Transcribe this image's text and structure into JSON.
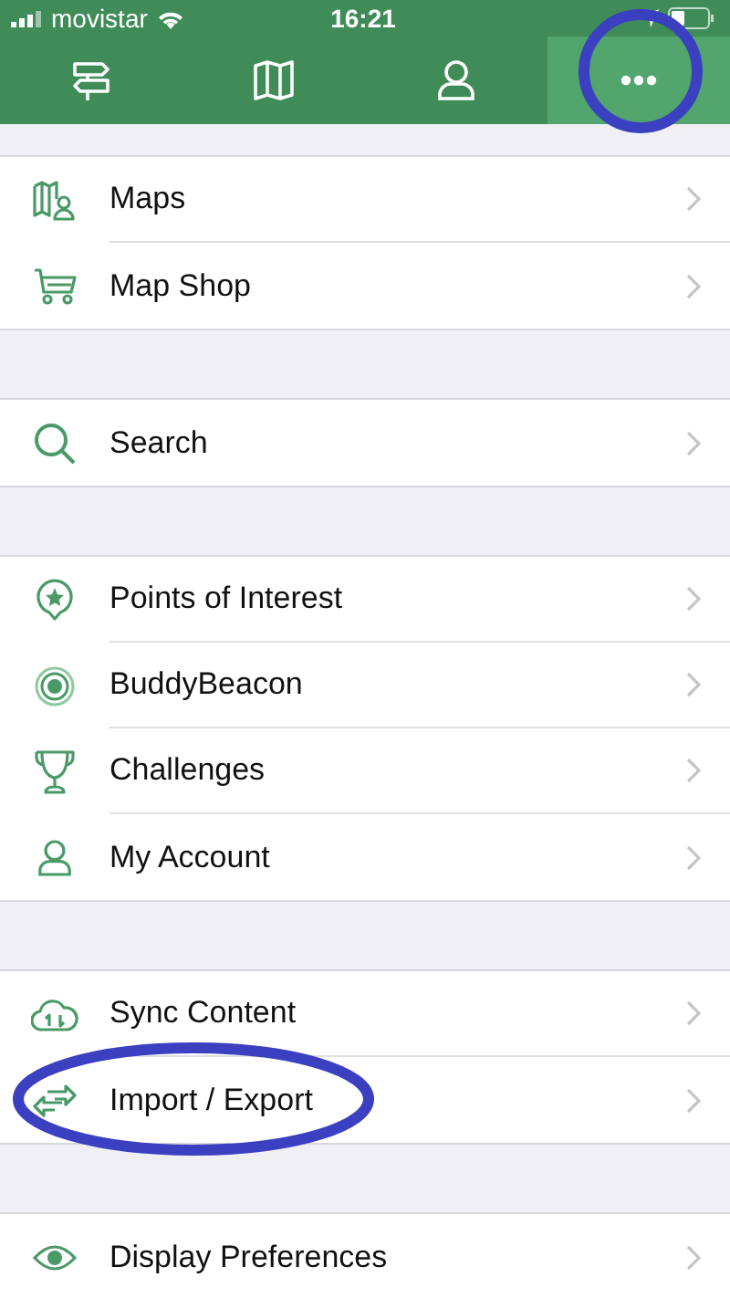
{
  "status_bar": {
    "carrier": "movistar",
    "time": "16:21"
  },
  "tabs": [
    {
      "selected": false,
      "circled": false
    },
    {
      "selected": false,
      "circled": false
    },
    {
      "selected": false,
      "circled": false
    },
    {
      "selected": true,
      "circled": true
    }
  ],
  "sections": [
    {
      "items": [
        {
          "label": "Maps",
          "circled": false
        },
        {
          "label": "Map Shop",
          "circled": false
        }
      ]
    },
    {
      "items": [
        {
          "label": "Search",
          "circled": false
        }
      ]
    },
    {
      "items": [
        {
          "label": "Points of Interest",
          "circled": false
        },
        {
          "label": "BuddyBeacon",
          "circled": false
        },
        {
          "label": "Challenges",
          "circled": false
        },
        {
          "label": "My Account",
          "circled": false
        }
      ]
    },
    {
      "items": [
        {
          "label": "Sync Content",
          "circled": false
        },
        {
          "label": "Import / Export",
          "circled": true
        }
      ]
    },
    {
      "items": [
        {
          "label": "Display Preferences",
          "circled": false
        }
      ]
    }
  ]
}
